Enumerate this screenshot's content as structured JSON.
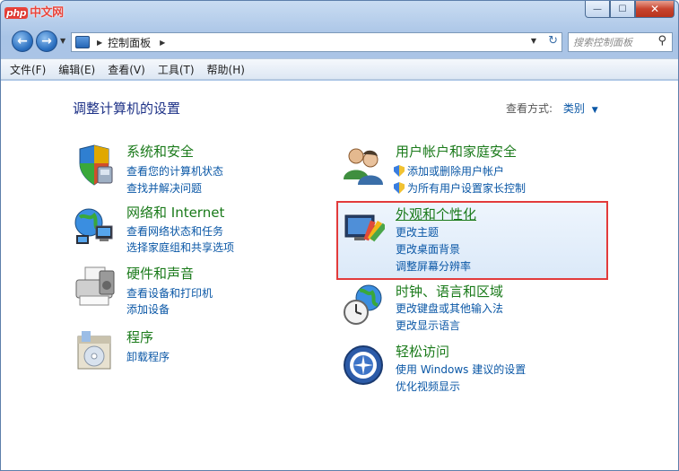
{
  "titlebar": {
    "logo_php": "php",
    "logo_cn": "中文网",
    "buttons": {
      "minimize": "—",
      "maximize": "☐",
      "close": "✕"
    }
  },
  "nav": {
    "back_icon": "back-arrow-icon",
    "forward_icon": "forward-arrow-icon",
    "address_path": "控制面板",
    "search_placeholder": "搜索控制面板"
  },
  "menu": {
    "items": [
      "文件(F)",
      "编辑(E)",
      "查看(V)",
      "工具(T)",
      "帮助(H)"
    ]
  },
  "main": {
    "heading": "调整计算机的设置",
    "view_by_label": "查看方式:",
    "view_by_value": "类别"
  },
  "categories": {
    "security": {
      "title": "系统和安全",
      "links": [
        "查看您的计算机状态",
        "查找并解决问题"
      ]
    },
    "network": {
      "title": "网络和 Internet",
      "links": [
        "查看网络状态和任务",
        "选择家庭组和共享选项"
      ]
    },
    "hardware": {
      "title": "硬件和声音",
      "links": [
        "查看设备和打印机",
        "添加设备"
      ]
    },
    "programs": {
      "title": "程序",
      "links": [
        "卸载程序"
      ]
    },
    "users": {
      "title": "用户帐户和家庭安全",
      "links": [
        "添加或删除用户帐户",
        "为所有用户设置家长控制"
      ]
    },
    "appearance": {
      "title": "外观和个性化",
      "links": [
        "更改主题",
        "更改桌面背景",
        "调整屏幕分辨率"
      ]
    },
    "clock": {
      "title": "时钟、语言和区域",
      "links": [
        "更改键盘或其他输入法",
        "更改显示语言"
      ]
    },
    "access": {
      "title": "轻松访问",
      "links": [
        "使用 Windows 建议的设置",
        "优化视频显示"
      ]
    }
  },
  "colors": {
    "title_green": "#1a7a1a",
    "link_blue": "#0a57a6",
    "highlight_red": "#e23b3b"
  }
}
